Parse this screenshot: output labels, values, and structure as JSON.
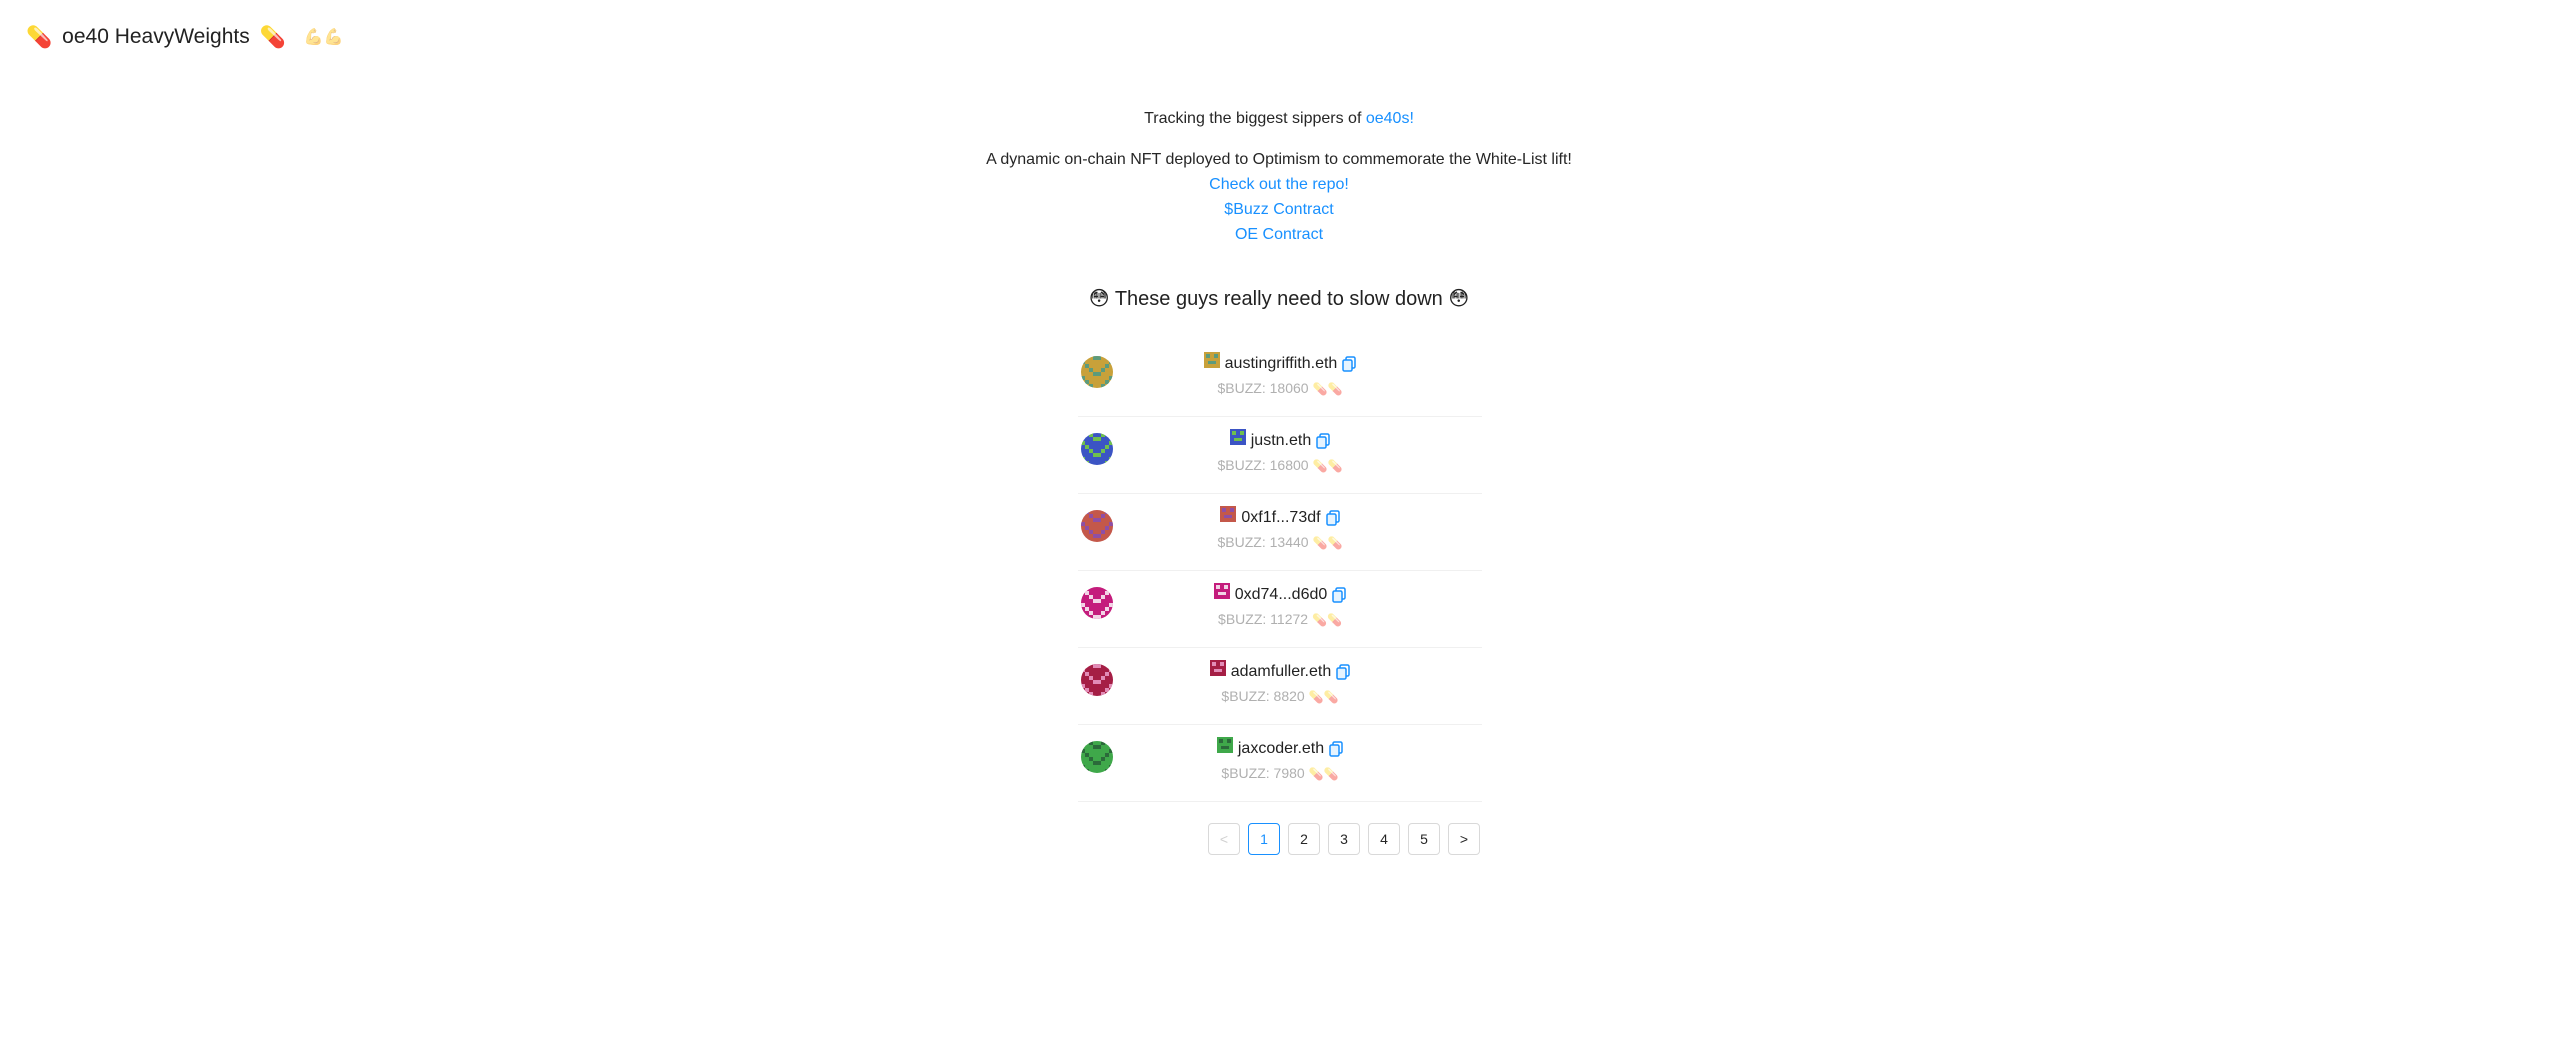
{
  "header": {
    "pill_left": "💊",
    "title": "oe40 HeavyWeights",
    "pill_right": "💊",
    "muscles": "💪💪"
  },
  "intro": {
    "tagline_prefix": "Tracking the biggest sippers of ",
    "tagline_link": "oe40s!",
    "description": "A dynamic on-chain NFT deployed to Optimism to commemorate the White-List lift!",
    "links": [
      "Check out the repo!",
      "$Buzz Contract",
      "OE Contract"
    ]
  },
  "section": {
    "title": "These guys really need to slow down",
    "emoji": "😳"
  },
  "leaders": [
    {
      "name": "austingriffith.eth",
      "buzz": "$BUZZ: 18060",
      "pills": "💊💊",
      "color": "#c8a13a",
      "accent": "#5d9b7c"
    },
    {
      "name": "justn.eth",
      "buzz": "$BUZZ: 16800",
      "pills": "💊💊",
      "color": "#3b54c4",
      "accent": "#6fbf4d"
    },
    {
      "name": "0xf1f...73df",
      "buzz": "$BUZZ: 13440",
      "pills": "💊💊",
      "color": "#c4584a",
      "accent": "#8e4fa6"
    },
    {
      "name": "0xd74...d6d0",
      "buzz": "$BUZZ: 11272",
      "pills": "💊💊",
      "color": "#c41c7c",
      "accent": "#f2d4e6"
    },
    {
      "name": "adamfuller.eth",
      "buzz": "$BUZZ: 8820",
      "pills": "💊💊",
      "color": "#a51e45",
      "accent": "#e28cb7"
    },
    {
      "name": "jaxcoder.eth",
      "buzz": "$BUZZ: 7980",
      "pills": "💊💊",
      "color": "#3fa84a",
      "accent": "#2b6a3a"
    }
  ],
  "pagination": {
    "prev": "<",
    "next": ">",
    "pages": [
      "1",
      "2",
      "3",
      "4",
      "5"
    ],
    "current": "1"
  }
}
